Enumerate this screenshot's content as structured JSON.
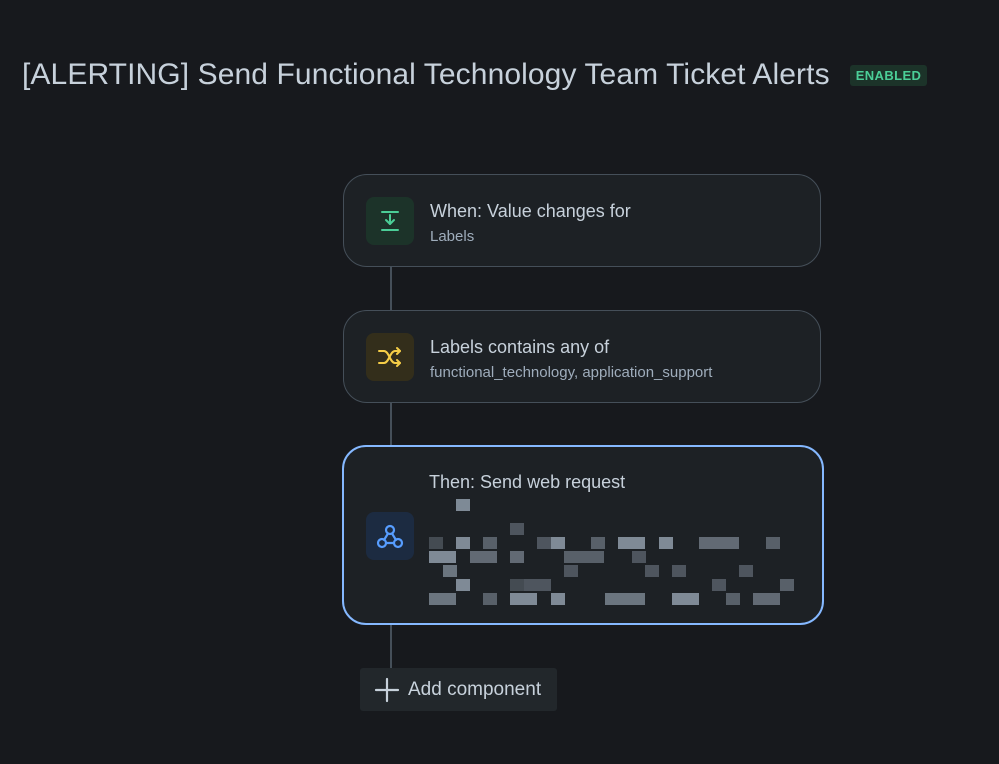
{
  "rule": {
    "title": "[ALERTING] Send Functional Technology Team Ticket Alerts",
    "status_badge": "ENABLED"
  },
  "components": [
    {
      "kind": "trigger",
      "icon": "trigger-download-icon",
      "title": "When: Value changes for",
      "subtitle": "Labels"
    },
    {
      "kind": "condition",
      "icon": "shuffle-icon",
      "title": "Labels contains any of",
      "subtitle": "functional_technology, application_support"
    },
    {
      "kind": "action",
      "icon": "webhook-icon",
      "title": "Then: Send web request",
      "subtitle_redacted": true
    }
  ],
  "add_component": {
    "label": "Add component",
    "icon": "plus-icon"
  },
  "colors": {
    "background": "#17191d",
    "card": "#1d2125",
    "card_border": "#454f59",
    "selected_border": "#85b8ff",
    "trigger_accent": "#4bce97",
    "condition_accent": "#f5cd47",
    "action_accent": "#579dff"
  }
}
